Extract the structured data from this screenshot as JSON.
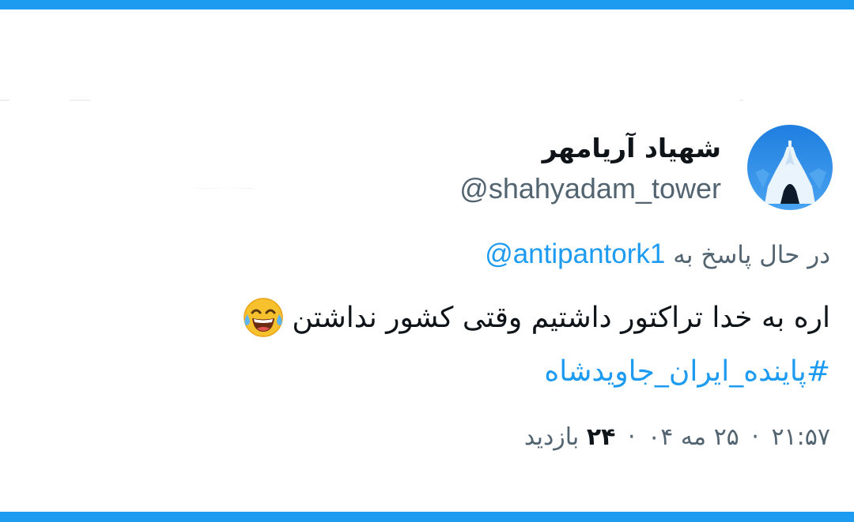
{
  "tweet": {
    "author": {
      "display_name": "شهیاد آریامهر",
      "handle": "@shahyadam_tower",
      "avatar_icon": "azadi-tower-avatar"
    },
    "reply": {
      "prefix": "در حال پاسخ به",
      "mention": "@antipantork1"
    },
    "text": "اره به خدا تراکتور داشتیم وقتی کشور نداشتن",
    "emoji": "face-with-tears-of-joy-icon",
    "hashtag": "#پاینده_ایران_جاویدشاه",
    "meta": {
      "time": "۲۱:۵۷",
      "dot": "·",
      "date": "۲۵ مه ۰۴",
      "views_count": "۲۴",
      "views_label": "بازدید"
    }
  },
  "colors": {
    "accent": "#1d9bf0",
    "text_primary": "#0f1419",
    "text_secondary": "#536471"
  }
}
